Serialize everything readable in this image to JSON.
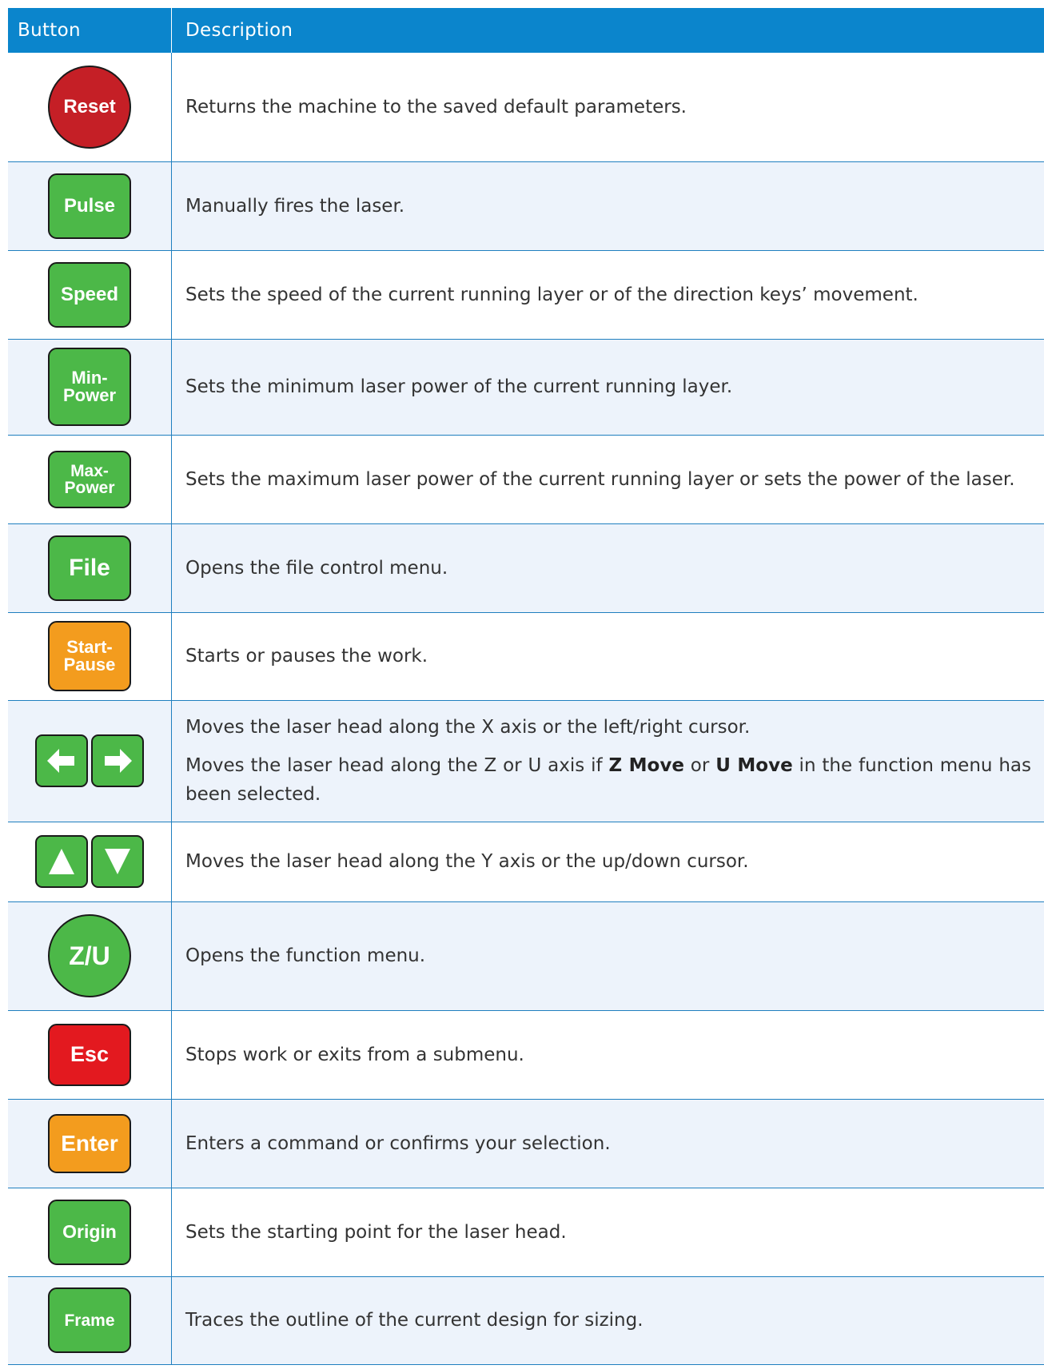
{
  "header": {
    "button_col": "Button",
    "desc_col": "Description"
  },
  "colors": {
    "header_bg": "#0b85cc",
    "green": "#4cb848",
    "orange": "#f39c1e",
    "red_key": "#e3191f",
    "reset_red": "#c51f26",
    "alt_row": "#edf3fb"
  },
  "rows": [
    {
      "key": "Reset",
      "color": "reset-red",
      "shape": "circle",
      "desc": [
        "Returns the machine to the saved default parameters."
      ]
    },
    {
      "key": "Pulse",
      "color": "green",
      "shape": "rounded",
      "desc": [
        "Manually fires the laser."
      ]
    },
    {
      "key": "Speed",
      "color": "green",
      "shape": "rounded",
      "desc": [
        "Sets the speed of the current running layer or of the direction keys’ movement."
      ]
    },
    {
      "key_line1": "Min-",
      "key_line2": "Power",
      "color": "green",
      "shape": "rounded",
      "desc": [
        "Sets the minimum laser power of the current running layer."
      ]
    },
    {
      "key_line1": "Max-",
      "key_line2": "Power",
      "color": "green",
      "shape": "rounded",
      "desc": [
        "Sets the maximum laser power of the current running layer or sets the power of the laser."
      ]
    },
    {
      "key": "File",
      "color": "green",
      "shape": "rounded",
      "desc": [
        "Opens the file control menu."
      ]
    },
    {
      "key_line1": "Start-",
      "key_line2": "Pause",
      "color": "orange",
      "shape": "rounded",
      "desc": [
        "Starts or pauses the work."
      ]
    },
    {
      "icons": [
        "arrow-left-icon",
        "arrow-right-icon"
      ],
      "color": "green",
      "desc": [
        "Moves the laser head along the X axis or the left/right cursor."
      ],
      "desc2": {
        "prefix": "Moves the laser head along the Z or U axis if ",
        "bold1": "Z Move",
        "mid": " or ",
        "bold2": "U Move",
        "suffix": " in the function menu has been selected."
      }
    },
    {
      "icons": [
        "arrow-up-icon",
        "arrow-down-icon"
      ],
      "color": "green",
      "desc": [
        "Moves the laser head along the Y axis or the up/down cursor."
      ]
    },
    {
      "key": "Z/U",
      "color": "green",
      "shape": "circle",
      "desc": [
        "Opens the function menu."
      ]
    },
    {
      "key": "Esc",
      "color": "red",
      "shape": "rounded",
      "desc": [
        "Stops work or exits from a submenu."
      ]
    },
    {
      "key": "Enter",
      "color": "orange",
      "shape": "rounded",
      "desc": [
        "Enters a command or confirms your selection."
      ]
    },
    {
      "key": "Origin",
      "color": "green",
      "shape": "rounded",
      "desc": [
        "Sets the starting point for the laser head."
      ]
    },
    {
      "key": "Frame",
      "color": "green",
      "shape": "rounded",
      "desc": [
        "Traces the outline of the current design for sizing."
      ]
    }
  ]
}
